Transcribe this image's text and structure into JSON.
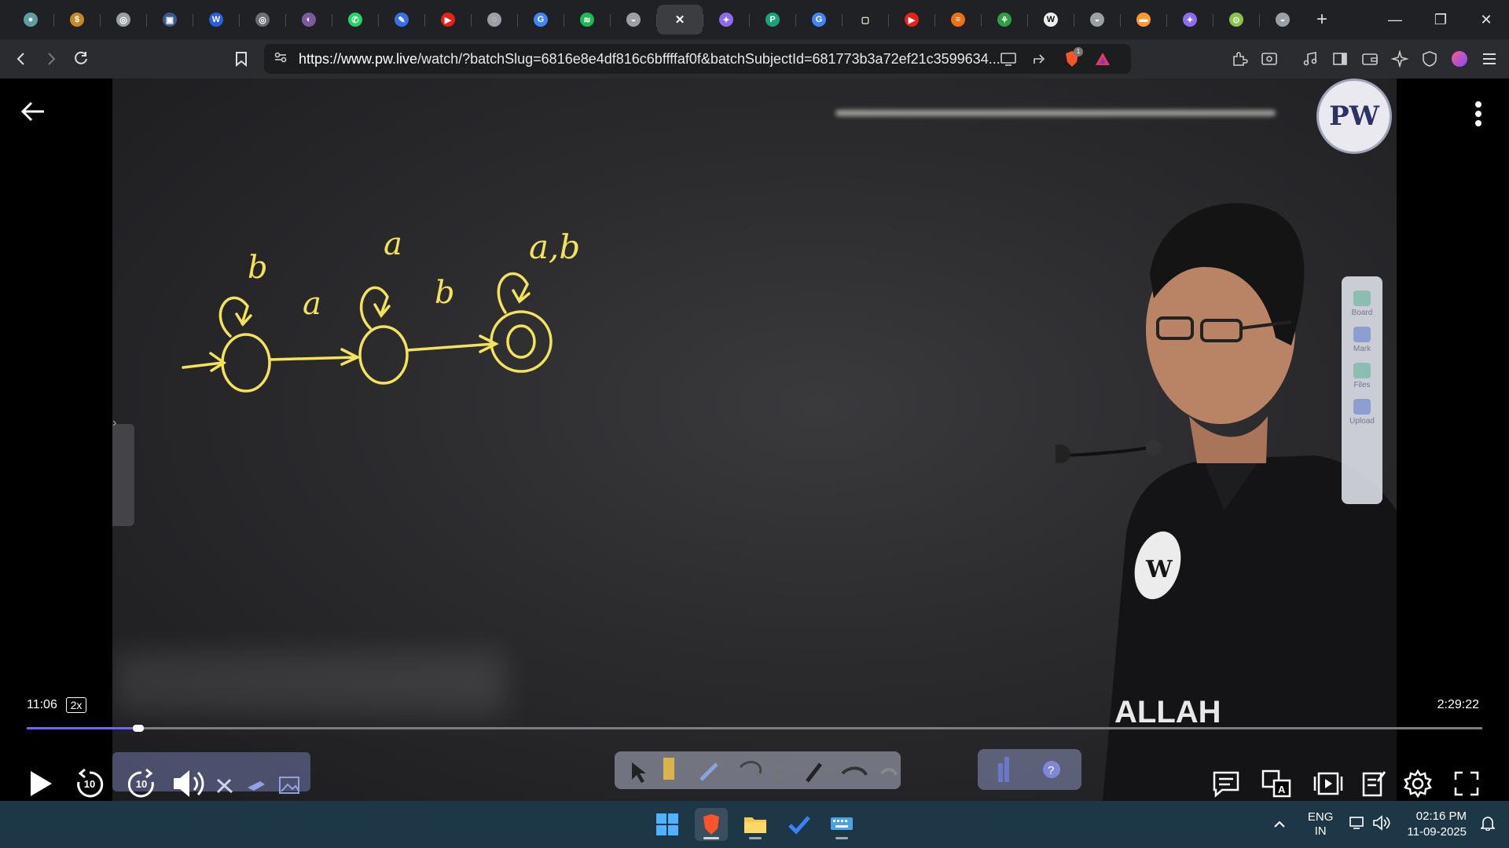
{
  "browser": {
    "tabs": [
      {
        "name": "tab-1",
        "color": "#5f9ea0",
        "glyph": "●"
      },
      {
        "name": "tab-2",
        "color": "#c48a2a",
        "glyph": "$"
      },
      {
        "name": "tab-3",
        "color": "#9aa0a6",
        "glyph": "◎"
      },
      {
        "name": "tab-4",
        "color": "#3b5b8c",
        "glyph": "▣"
      },
      {
        "name": "tab-5",
        "color": "#2b5fd9",
        "glyph": "W"
      },
      {
        "name": "tab-6",
        "color": "#6b6f75",
        "glyph": "◎"
      },
      {
        "name": "tab-7",
        "color": "#7a5c9e",
        "glyph": "◐"
      },
      {
        "name": "tab-8",
        "color": "#25d366",
        "glyph": "✆"
      },
      {
        "name": "tab-9",
        "color": "#3b6ee6",
        "glyph": "✎"
      },
      {
        "name": "tab-10",
        "color": "#e62117",
        "glyph": "▶"
      },
      {
        "name": "tab-11",
        "color": "#9aa0a6",
        "glyph": "◌"
      },
      {
        "name": "tab-12",
        "color": "#4285f4",
        "glyph": "G"
      },
      {
        "name": "tab-13",
        "color": "#1db954",
        "glyph": "≋"
      },
      {
        "name": "tab-14",
        "color": "#9aa0a6",
        "glyph": "◒"
      },
      {
        "name": "tab-15-active",
        "color": "#3c3d41",
        "glyph": "✕",
        "active": true
      },
      {
        "name": "tab-16",
        "color": "#8e6cf0",
        "glyph": "✦"
      },
      {
        "name": "tab-17",
        "color": "#1aa37a",
        "glyph": "P"
      },
      {
        "name": "tab-18",
        "color": "#4285f4",
        "glyph": "G"
      },
      {
        "name": "tab-19",
        "color": "#222",
        "glyph": "▢"
      },
      {
        "name": "tab-20",
        "color": "#e62117",
        "glyph": "▶"
      },
      {
        "name": "tab-21",
        "color": "#e8711a",
        "glyph": "≡"
      },
      {
        "name": "tab-22",
        "color": "#2ea043",
        "glyph": "⚘"
      },
      {
        "name": "tab-23",
        "color": "#eeeeee",
        "glyph": "W"
      },
      {
        "name": "tab-24",
        "color": "#9aa0a6",
        "glyph": "◒"
      },
      {
        "name": "tab-25",
        "color": "#ff9933",
        "glyph": "▬"
      },
      {
        "name": "tab-26",
        "color": "#8e6cf0",
        "glyph": "✦"
      },
      {
        "name": "tab-27",
        "color": "#8bc34a",
        "glyph": "⊙"
      },
      {
        "name": "tab-28",
        "color": "#9aa0a6",
        "glyph": "◒"
      }
    ],
    "url_domain": "https://www.pw.live",
    "url_rest": "/watch/?batchSlug=6816e8e4df816c6bffffaf0f&batchSubjectId=681773b3a72ef21c3599634...",
    "brave_badge": "1",
    "colors": {
      "tabstrip": "#202124",
      "toolbar": "#2b2c2f",
      "accent": "#6d63ff"
    }
  },
  "player": {
    "time_elapsed": "11:06",
    "speed": "2x",
    "time_total": "2:29:22",
    "progress_fraction": 0.075,
    "skip_back": "10",
    "skip_forward": "10",
    "logo_text": "PW",
    "side_tools": [
      "Board",
      "Mark",
      "Files",
      "Upload"
    ],
    "board_drawing": {
      "loops": [
        "b",
        "a",
        "a,b"
      ],
      "transitions": [
        "a",
        "b"
      ]
    },
    "shirt_text": "ALLAH"
  },
  "taskbar": {
    "lang_top": "ENG",
    "lang_bottom": "IN",
    "time": "02:16 PM",
    "date": "11-09-2025"
  }
}
